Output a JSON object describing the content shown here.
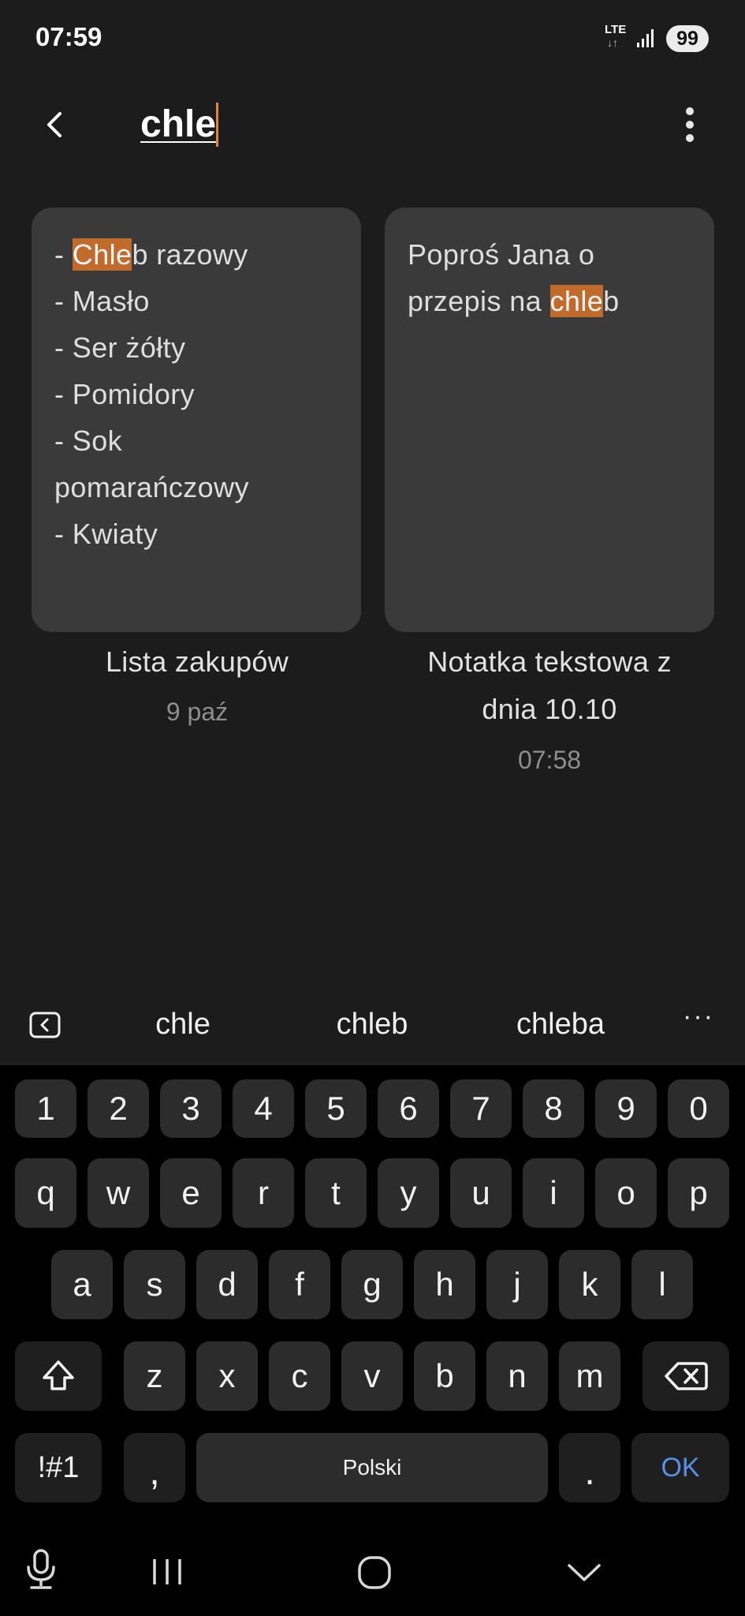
{
  "status_bar": {
    "time": "07:59",
    "network": "LTE",
    "network_arrows": "↓↑",
    "battery": "99"
  },
  "header": {
    "search_value": "chle"
  },
  "notes": [
    {
      "body_lines": [
        {
          "pre": "- ",
          "hl": "Chle",
          "post": "b razowy"
        },
        {
          "pre": "- Masło",
          "hl": "",
          "post": ""
        },
        {
          "pre": "- Ser żółty",
          "hl": "",
          "post": ""
        },
        {
          "pre": "- Pomidory",
          "hl": "",
          "post": ""
        },
        {
          "pre": "- Sok",
          "hl": "",
          "post": ""
        },
        {
          "pre": "pomarańczowy",
          "hl": "",
          "post": ""
        },
        {
          "pre": "- Kwiaty",
          "hl": "",
          "post": ""
        }
      ],
      "title": "Lista zakupów",
      "date": "9 paź"
    },
    {
      "body_lines": [
        {
          "pre": "Poproś Jana o",
          "hl": "",
          "post": ""
        },
        {
          "pre": "przepis na ",
          "hl": "chle",
          "post": "b"
        }
      ],
      "title_line1": "Notatka tekstowa z",
      "title_line2": "dnia 10.10",
      "date": "07:58"
    }
  ],
  "keyboard": {
    "suggestions": [
      "chle",
      "chleb",
      "chleba"
    ],
    "more": "···",
    "numbers": [
      "1",
      "2",
      "3",
      "4",
      "5",
      "6",
      "7",
      "8",
      "9",
      "0"
    ],
    "row1": [
      "q",
      "w",
      "e",
      "r",
      "t",
      "y",
      "u",
      "i",
      "o",
      "p"
    ],
    "row2": [
      "a",
      "s",
      "d",
      "f",
      "g",
      "h",
      "j",
      "k",
      "l"
    ],
    "row3": [
      "z",
      "x",
      "c",
      "v",
      "b",
      "n",
      "m"
    ],
    "symbols": "!#1",
    "comma": ",",
    "space": "Polski",
    "period": ".",
    "ok": "OK"
  },
  "colors": {
    "background": "#1c1c1c",
    "card": "#3b3a3a",
    "highlight": "#c06a2c",
    "accent_ok": "#5a8fe8",
    "caret": "#e8823a"
  }
}
